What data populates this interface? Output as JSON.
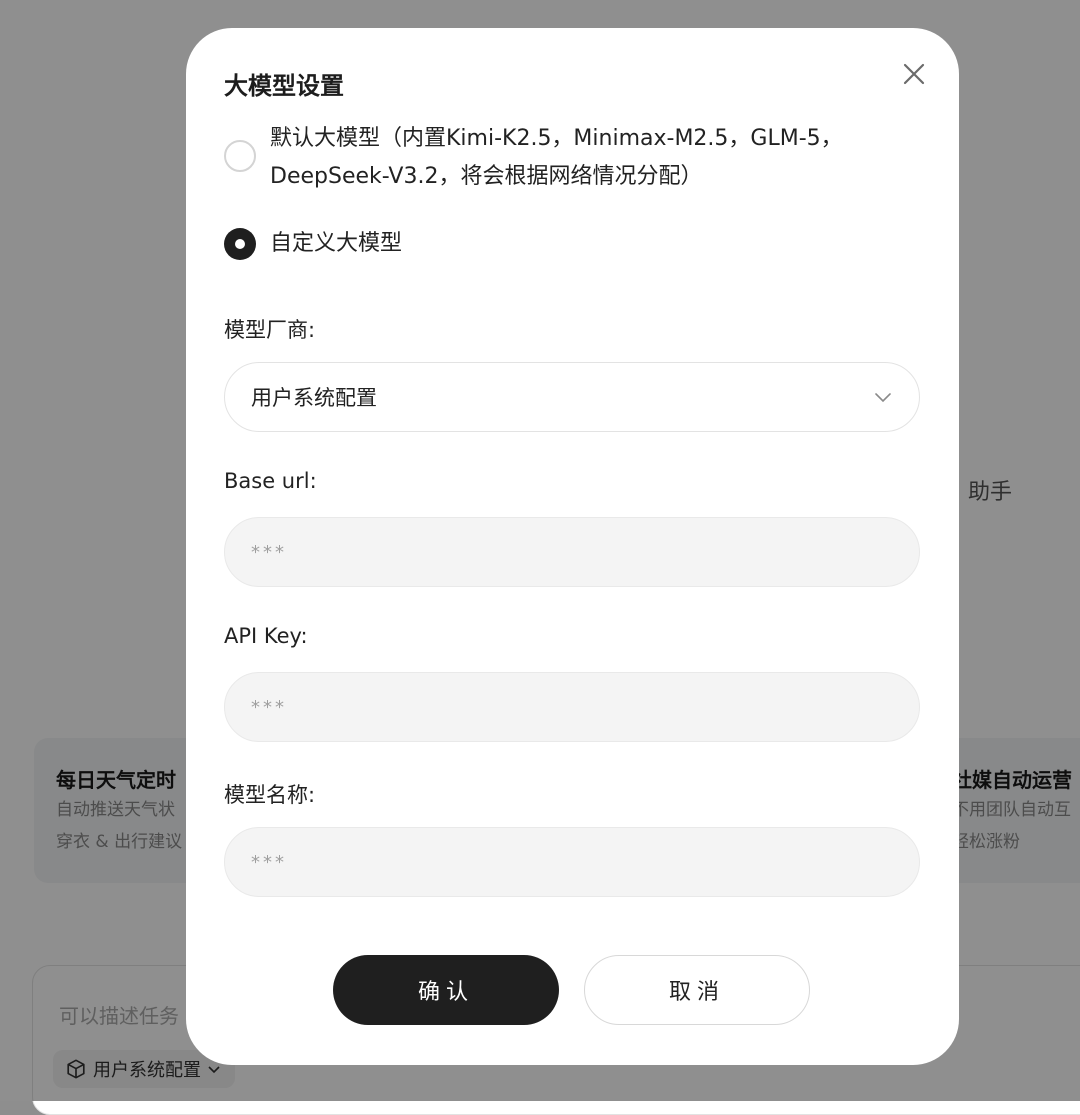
{
  "background": {
    "helper_text": "助手",
    "cards": [
      {
        "title": "每日天气定时",
        "desc_line1": "自动推送天气状",
        "desc_line2": "穿衣 & 出行建议"
      },
      {
        "title": "社媒自动运营",
        "desc_line1": "不用团队自动互",
        "desc_line2": "轻松涨粉"
      }
    ],
    "input_placeholder": "可以描述任务",
    "config_chip_label": "用户系统配置"
  },
  "modal": {
    "title": "大模型设置",
    "options": [
      {
        "label": "默认大模型（内置Kimi-K2.5，Minimax-M2.5，GLM-5，DeepSeek-V3.2，将会根据网络情况分配）",
        "checked": false
      },
      {
        "label": "自定义大模型",
        "checked": true
      }
    ],
    "vendor_label": "模型厂商:",
    "vendor_value": "用户系统配置",
    "base_url_label": "Base url:",
    "base_url_placeholder": "***",
    "api_key_label": "API Key:",
    "api_key_placeholder": "***",
    "model_name_label": "模型名称:",
    "model_name_placeholder": "***",
    "confirm_label": "确认",
    "cancel_label": "取消"
  },
  "colors": {
    "primary_button": "#1f1f1f",
    "overlay": "rgba(0,0,0,0.44)"
  }
}
